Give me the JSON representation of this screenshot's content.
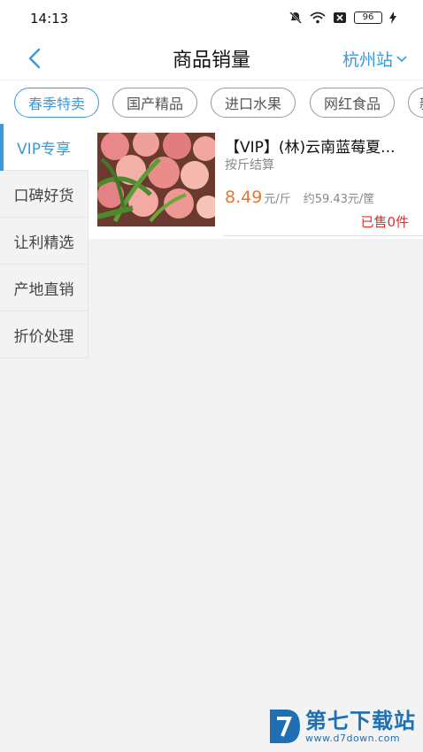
{
  "status": {
    "time": "14:13",
    "battery": "96"
  },
  "header": {
    "title": "商品销量",
    "station": "杭州站"
  },
  "categories": [
    "春季特卖",
    "国产精品",
    "进口水果",
    "网红食品",
    "新"
  ],
  "sidebar": [
    "VIP专享",
    "口碑好货",
    "让利精选",
    "产地直销",
    "折价处理"
  ],
  "product": {
    "name": "【VIP】(林)云南蓝莓夏...",
    "unit_note": "按斤结算",
    "price": "8.49",
    "price_unit": "元/斤",
    "approx": "约59.43元/筐",
    "sold": "已售0件"
  },
  "watermark": {
    "name": "第七下载站",
    "url": "www.d7down.com"
  },
  "colors": {
    "accent": "#3a9ad9",
    "price": "#e07a32",
    "sold": "#e0302a"
  }
}
